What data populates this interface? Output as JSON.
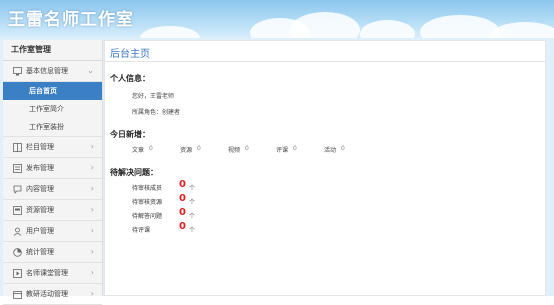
{
  "header": {
    "site_title": "王雷名师工作室"
  },
  "sidebar": {
    "title": "工作室管理",
    "groups": [
      {
        "label": "基本信息管理",
        "icon": "monitor-icon",
        "expanded": true,
        "children": [
          {
            "label": "后台首页",
            "active": true
          },
          {
            "label": "工作室简介",
            "active": false
          },
          {
            "label": "工作室装扮",
            "active": false
          }
        ]
      },
      {
        "label": "栏目管理",
        "icon": "grid-icon"
      },
      {
        "label": "发布管理",
        "icon": "publish-icon"
      },
      {
        "label": "内容管理",
        "icon": "comment-icon"
      },
      {
        "label": "资源管理",
        "icon": "resource-icon"
      },
      {
        "label": "用户管理",
        "icon": "user-icon"
      },
      {
        "label": "统计管理",
        "icon": "chart-icon"
      },
      {
        "label": "名师课堂管理",
        "icon": "classroom-icon"
      },
      {
        "label": "教研活动管理",
        "icon": "activity-icon"
      }
    ]
  },
  "main": {
    "title": "后台主页",
    "personal": {
      "heading": "个人信息：",
      "greeting": "您好，王雷老师",
      "role": "所属角色：创建者"
    },
    "today": {
      "heading": "今日新增：",
      "stats": [
        {
          "label": "文章",
          "value": "0"
        },
        {
          "label": "资源",
          "value": "0"
        },
        {
          "label": "视频",
          "value": "0"
        },
        {
          "label": "评课",
          "value": "0"
        },
        {
          "label": "活动",
          "value": "0"
        }
      ]
    },
    "pending": {
      "heading": "待解决问题：",
      "items": [
        {
          "label": "待审核成员",
          "count": "0",
          "unit": "个"
        },
        {
          "label": "待审核资源",
          "count": "0",
          "unit": "个"
        },
        {
          "label": "待解答问题",
          "count": "0",
          "unit": "个"
        },
        {
          "label": "待评课",
          "count": "0",
          "unit": "个"
        }
      ]
    }
  }
}
